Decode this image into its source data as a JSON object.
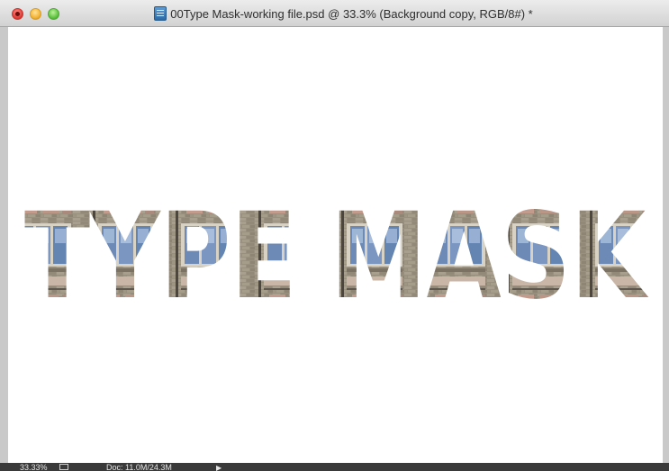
{
  "window": {
    "title": "00Type Mask-working file.psd @ 33.3% (Background copy, RGB/8#) *"
  },
  "canvas": {
    "text": "TYPE MASK"
  },
  "status_bar": {
    "zoom": "33.33%",
    "doc": "Doc: 11.0M/24.3M",
    "arrow": "▶"
  },
  "colors": {
    "canvas_bg": "#ffffff",
    "statusbar_bg": "#3a3a3a"
  }
}
